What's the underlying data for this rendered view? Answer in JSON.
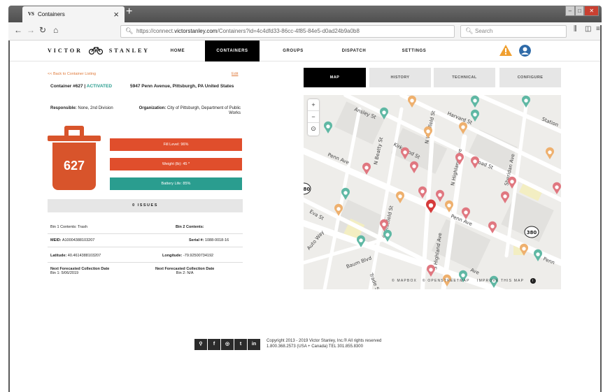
{
  "browser": {
    "tab_icon": "VS",
    "tab_title": "Containers",
    "tab_close": "×",
    "new_tab": "+",
    "url_prefix": "https://connect.",
    "url_domain": "victorstanley.com",
    "url_path": "/Containers?id=4c4dfd33-86cc-4f85-84e5-d0ad24b9a0b8",
    "search_placeholder": "Search",
    "back_icon": "arrow-left-icon",
    "forward_icon": "arrow-right-icon",
    "reload_icon": "reload-icon",
    "home_icon": "home-icon"
  },
  "header": {
    "logo_left": "VICTOR",
    "logo_right": "STANLEY",
    "nav": [
      {
        "label": "HOME",
        "active": false
      },
      {
        "label": "CONTAINERS",
        "active": true
      },
      {
        "label": "GROUPS",
        "active": false
      },
      {
        "label": "DISPATCH",
        "active": false
      },
      {
        "label": "SETTINGS",
        "active": false
      }
    ],
    "alert_color": "#f0a030",
    "user_color": "#2e6aa8"
  },
  "detail": {
    "back_link": "<< Back to Container Listing",
    "edit_link": "Edit",
    "container_label": "Container #627 | ",
    "status": "ACTIVATED",
    "address": "5947 Penn Avenue, Pittsburgh, PA United States",
    "responsible_label": "Responsible:",
    "responsible_value": "None, 2nd Division",
    "organization_label": "Organization:",
    "organization_value": "City of Pittsburgh, Department of Public Works",
    "bin_number": "627",
    "fill_level": "Fill Level: 96%",
    "weight": "Weight (lb): 45 *",
    "battery": "Battery Life: 85%",
    "issues_label": "0 ISSUES",
    "bin1_contents": "Bin 1 Contents: Trash",
    "bin2_contents": "Bin 2 Contents:",
    "meid_label": "MEID:",
    "meid_value": "A10004388103207",
    "serial_label": "Serial #:",
    "serial_value": "1088-0018-16",
    "latitude_label": "Latitude:",
    "latitude_value": "40.4614388103207",
    "longitude_label": "Longitude:",
    "longitude_value": "-79.92500734192",
    "forecast_title": "Next Forecasted Collection Date",
    "forecast_bin1": "Bin 1: 5/06/2019",
    "forecast_bin2": "Bin 2: N/A"
  },
  "tabs": [
    {
      "label": "MAP",
      "active": true
    },
    {
      "label": "HISTORY",
      "active": false
    },
    {
      "label": "TECHNICAL",
      "active": false
    },
    {
      "label": "CONFIGURE",
      "active": false
    }
  ],
  "map": {
    "zoom_in": "+",
    "zoom_out": "−",
    "locate_icon": "crosshair-icon",
    "streets": [
      "Ansley St",
      "Harvard St",
      "Station",
      "Kirkwood St",
      "N Whitfield St",
      "N Beatty St",
      "Penn Ave",
      "Broad St",
      "N Highland Ave",
      "Sheridan Ave",
      "Ardwick St",
      "Eva St",
      "Penn Ave",
      "Auto Way",
      "S Whitfield St",
      "S Highland Ave",
      "Baum Blvd",
      "Penn",
      "Trade St",
      "Ave"
    ],
    "shields": [
      "380",
      "380"
    ],
    "attribution_1": "© MAPBOX",
    "attribution_2": "© OPENSTREETMAP",
    "attribution_3": "IMPROVE THIS MAP",
    "info_icon": "i",
    "colors": {
      "red": "#e07780",
      "teal": "#5fb8a4",
      "orange": "#eeb06e",
      "selected": "#d63b3b"
    }
  },
  "footer": {
    "social": [
      "bike-icon",
      "facebook-icon",
      "instagram-icon",
      "twitter-icon",
      "linkedin-icon"
    ],
    "social_glyphs": [
      "⚲",
      "f",
      "◎",
      "t",
      "in"
    ],
    "copyright": "Copyright 2013 - 2019 Victor Stanley, Inc.® All rights reserved",
    "contact": "1.800.368.2573 (USA + Canada) TEL 301.855.8300"
  }
}
